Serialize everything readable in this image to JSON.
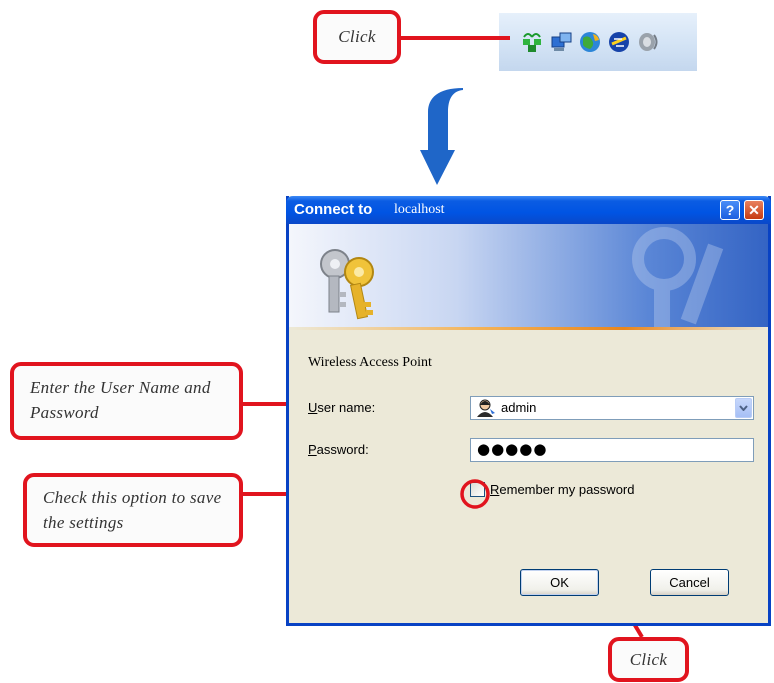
{
  "callouts": {
    "click_top": "Click",
    "credentials": "Enter the User Name and Password",
    "checkbox": "Check this option to save the settings",
    "click_bottom": "Click"
  },
  "tray_icons": [
    "wireless-network-icon",
    "network-computer-icon",
    "globe-icon",
    "network-connect-icon",
    "speaker-icon"
  ],
  "dialog": {
    "title_bold": "Connect to",
    "title_host": "localhost",
    "help_label": "?",
    "close_label": "✕",
    "realm": "Wireless Access Point",
    "username_label_accel": "U",
    "username_label_rest": "ser name:",
    "username_value": "admin",
    "password_label_accel": "P",
    "password_label_rest": "assword:",
    "password_value": "●●●●●",
    "remember_accel": "R",
    "remember_rest": "emember my password",
    "remember_checked": false,
    "ok_label": "OK",
    "cancel_label": "Cancel"
  },
  "colors": {
    "callout_border": "#e1141e",
    "arrow": "#1f66c8",
    "title_bar": "#0054e3",
    "dialog_face": "#ece9d8"
  }
}
